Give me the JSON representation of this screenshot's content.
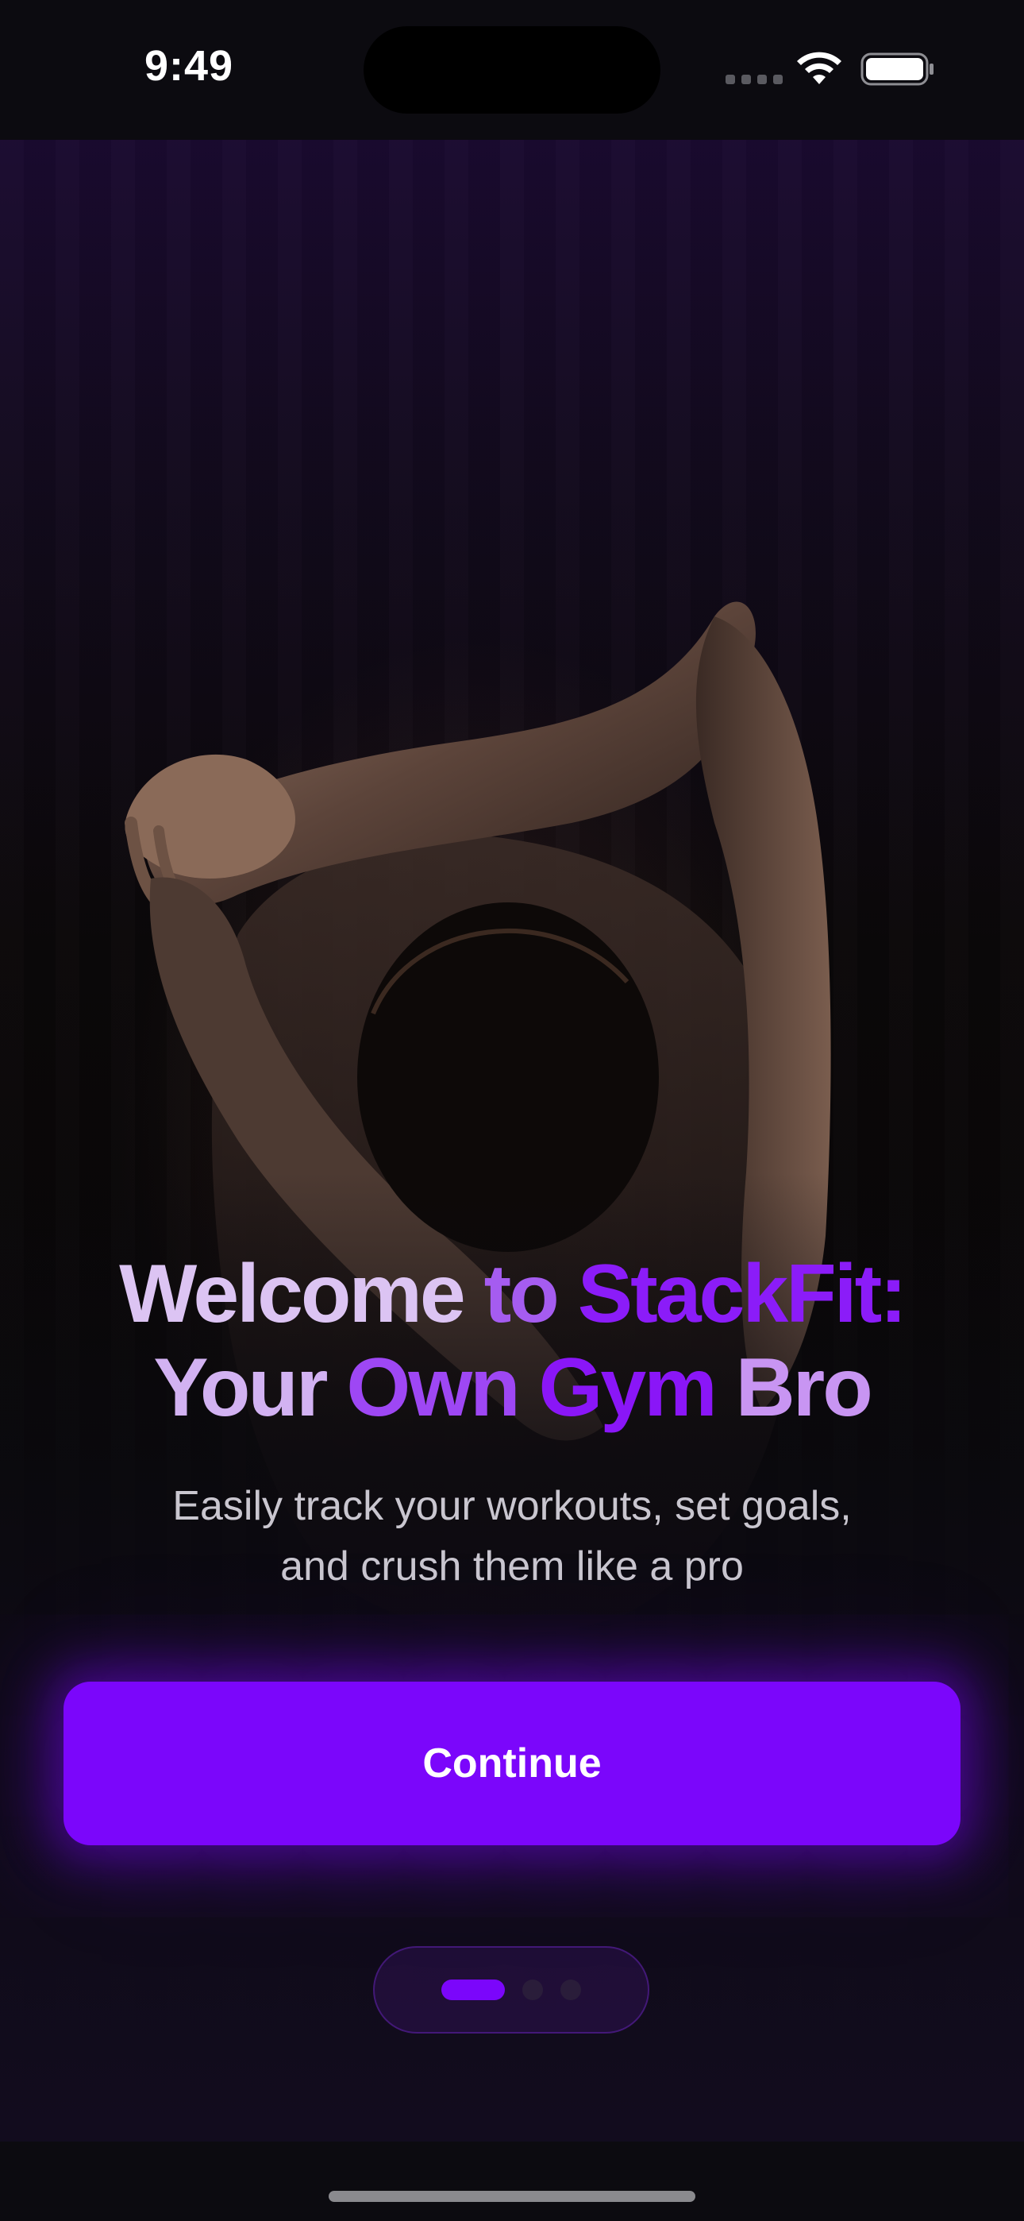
{
  "status_bar": {
    "time": "9:49"
  },
  "onboarding": {
    "headline_line1": {
      "part1": "Welcome ",
      "part2": "to ",
      "part3": "StackFit:"
    },
    "headline_line2": {
      "part1": "Your ",
      "part2": "Own ",
      "part3": "Gym ",
      "part4": "Bro"
    },
    "subtitle_line1": "Easily track your workouts, set goals,",
    "subtitle_line2": "and crush them like a pro",
    "continue_label": "Continue",
    "page_indicator": {
      "current_page": 1,
      "total_pages": 3
    }
  },
  "colors": {
    "accent": "#7b06fb",
    "background": "#0b0a0f",
    "headline_light": "#dcc4f3",
    "headline_purple": "#8b1cf8",
    "subtitle": "#c9c6cf"
  },
  "icons": {
    "wifi": "wifi-icon",
    "battery": "battery-icon",
    "signal": "cellular-signal-icon"
  }
}
